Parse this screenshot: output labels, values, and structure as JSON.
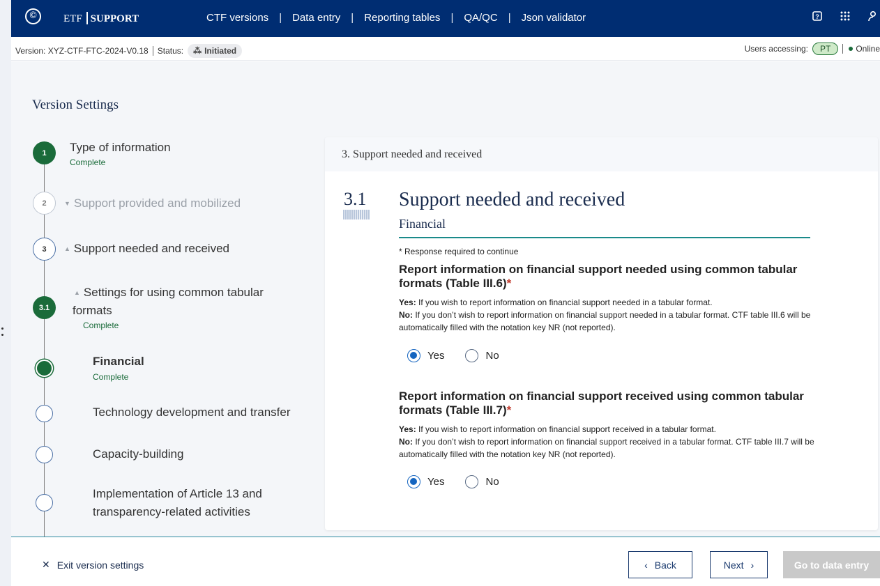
{
  "navbar": {
    "logo_glyph": "©",
    "brand_left": "ETF",
    "brand_right": "SUPPORT",
    "links": [
      "CTF versions",
      "Data entry",
      "Reporting tables",
      "QA/QC",
      "Json validator"
    ],
    "icons": [
      "help-icon",
      "apps-grid-icon",
      "user-icon"
    ]
  },
  "status_bar": {
    "version": "Version: XYZ-CTF-FTC-2024-V0.18",
    "status_label": "Status:",
    "status_value": "Initiated",
    "users_label": "Users accessing:",
    "user_initials": "PT",
    "online_label": "Online"
  },
  "page": {
    "title": "Version Settings"
  },
  "stepper": {
    "steps": [
      {
        "number": "1",
        "label": "Type of information",
        "status": "Complete"
      },
      {
        "number": "2",
        "label": "Support provided and mobilized"
      },
      {
        "number": "3",
        "label": "Support needed and received"
      },
      {
        "number": "3.1",
        "label_line1": "Settings for using common tabular",
        "label_line2": "formats",
        "status": "Complete"
      }
    ],
    "substeps": [
      {
        "label": "Financial",
        "status": "Complete"
      },
      {
        "label": "Technology development and transfer"
      },
      {
        "label": "Capacity-building"
      },
      {
        "label_line1": "Implementation of Article 13 and",
        "label_line2": "transparency-related activities"
      }
    ]
  },
  "card": {
    "header": "3. Support needed and received",
    "section_number": "3.1",
    "section_title": "Support needed and received",
    "section_subtitle": "Financial",
    "required_note": "* Response required to continue",
    "questions": [
      {
        "title": "Report information on financial support needed using common tabular formats (Table III.6)",
        "required_mark": "*",
        "yes_label": "Yes:",
        "yes_text": "If you wish to report information on financial support needed in a tabular format.",
        "no_label": "No:",
        "no_text": "If you don’t wish to report information on financial support needed in a tabular format. CTF table III.6 will be automatically filled with the notation key NR (not reported).",
        "options": [
          "Yes",
          "No"
        ],
        "selected": "Yes"
      },
      {
        "title": "Report information on financial support received using common tabular formats (Table III.7)",
        "required_mark": "*",
        "yes_label": "Yes:",
        "yes_text": "If you wish to report information on financial support received in a tabular format.",
        "no_label": "No:",
        "no_text": "If you don’t wish to report information on financial support received in a tabular format. CTF table III.7 will be automatically filled with the notation key NR (not reported).",
        "options": [
          "Yes",
          "No"
        ],
        "selected": "Yes"
      }
    ]
  },
  "footer": {
    "exit_label": "Exit version settings",
    "back_label": "Back",
    "next_label": "Next",
    "go_label": "Go to data entry"
  },
  "colors": {
    "navbar": "#002d72",
    "complete_green": "#1a6b3a",
    "radio_blue": "#1565c0",
    "accent_teal": "#1a8a8a"
  }
}
